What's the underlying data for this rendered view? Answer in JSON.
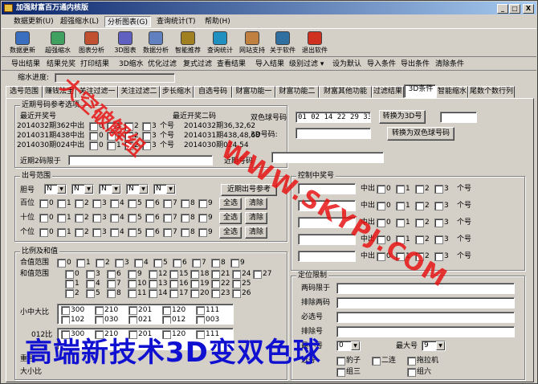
{
  "title": "加强财富百万通内核版",
  "title_buttons": [
    "_",
    "□",
    "X"
  ],
  "menus": [
    "数据更新(U)",
    "超强缩水(L)",
    "分析图表(G)",
    "查询统计(T)",
    "帮助(H)"
  ],
  "toolbar": [
    {
      "label": "数据更新",
      "icon": "database-update-icon",
      "color": "#3a6fc0"
    },
    {
      "label": "超强缩水",
      "icon": "filter-icon",
      "color": "#40a060"
    },
    {
      "label": "图表分析",
      "icon": "chart-icon",
      "color": "#c05030"
    },
    {
      "label": "3D图表",
      "icon": "3d-chart-icon",
      "color": "#6060c0"
    },
    {
      "label": "数据分析",
      "icon": "gear-icon",
      "color": "#6080c0"
    },
    {
      "label": "智能推荐",
      "icon": "magic-wand-icon",
      "color": "#a08020"
    },
    {
      "label": "查询统计",
      "icon": "globe-icon",
      "color": "#2090c0"
    },
    {
      "label": "网站支持",
      "icon": "house-icon",
      "color": "#c08040"
    },
    {
      "label": "关于软件",
      "icon": "info-icon",
      "color": "#3070a0"
    },
    {
      "label": "退出软件",
      "icon": "power-icon",
      "color": "#d03020"
    }
  ],
  "commands": [
    "导出结果",
    "结果兑奖",
    "打印结果",
    "3D缩水",
    "优化过滤",
    "复式过滤",
    "查看结果",
    "导入结果",
    "级别过滤 ▾",
    "设为默认",
    "导入条件",
    "导出条件",
    "清除条件"
  ],
  "progress_label": "缩水进度:",
  "tabs": [
    "选号范围",
    "赚钱法宝",
    "关注过滤一",
    "关注过滤二",
    "步长缩水",
    "自选号码",
    "财富功能一",
    "财富功能二",
    "财富其他功能",
    "过滤结果",
    "3D条件",
    "智能缩水",
    "尾数个数行列"
  ],
  "recent": {
    "title": "近期号码参考选项",
    "left_header": "最近开奖号",
    "right_header": "最近开奖二码",
    "rows": [
      {
        "period": "2014032期362中出",
        "count": "个号",
        "prize": "2014032期36,32,62"
      },
      {
        "period": "2014031期438中出",
        "count": "个号",
        "prize": "2014031期438,48,68"
      },
      {
        "period": "2014030期024中出",
        "count": "个号",
        "prize": "2014030期024,54"
      }
    ],
    "boxes": [
      "0",
      "1",
      "2",
      "3"
    ],
    "near_limit": "近期2码限于",
    "near_number": "近期号码"
  },
  "convert": {
    "two_color_label": "双色球号码",
    "two_color_value": "01 02 14 22 29 33",
    "to3d_btn": "转换为3D号",
    "d3_label": "3D号码:",
    "to2color_btn": "转换为双色球号码"
  },
  "range": {
    "title": "出号范围",
    "gall": "胆号",
    "combo": [
      "N",
      "N",
      "N",
      "N",
      "N"
    ],
    "recent_btn": "近期出号参考",
    "rows": [
      "百位",
      "十位",
      "个位"
    ],
    "digits": [
      "0",
      "1",
      "2",
      "3",
      "4",
      "5",
      "6",
      "7",
      "8",
      "9"
    ],
    "all_btn": "全选",
    "clear_btn": "清除"
  },
  "sum": {
    "title": "比例及和值",
    "he_range": "合值范围",
    "he_vals": [
      "0",
      "1",
      "2",
      "3",
      "4",
      "5",
      "6",
      "7",
      "8",
      "9"
    ],
    "sum_label": "和值范围",
    "sum_vals": [
      "0",
      "3",
      "6",
      "9",
      "12",
      "15",
      "18",
      "21",
      "24",
      "27",
      "1",
      "4",
      "7",
      "10",
      "13",
      "16",
      "19",
      "22",
      "25",
      "2",
      "5",
      "8",
      "11",
      "14",
      "17",
      "20",
      "23",
      "26"
    ],
    "big_small": "小中大比",
    "bs_vals": [
      "300",
      "210",
      "201",
      "120",
      "111",
      "102",
      "030",
      "021",
      "012",
      "003"
    ],
    "odd_even": "012比",
    "oe_vals": [
      "300",
      "210",
      "201",
      "120",
      "111"
    ],
    "last1": "重号",
    "last2": "大小比"
  },
  "control": {
    "title": "控制中奖号",
    "hit": "中出",
    "unit": "个号",
    "boxes": [
      "0",
      "1",
      "2",
      "3"
    ]
  },
  "position": {
    "title": "定位限制",
    "two_limit": "两码限于",
    "excl_limit": "排除两码",
    "must_select": "必选号",
    "excl_num": "排除号",
    "small_label": "最小号",
    "small_val": "0",
    "big_label": "最大号",
    "big_val": "9",
    "shape": "选号",
    "shape_opts": [
      "豹子",
      "二连",
      "拖拉机",
      "组三",
      "组六"
    ]
  },
  "watermark": {
    "crack": "大空破解组",
    "url": "WWW.SKYPJ.COM",
    "ad": "高端新技术3D变双色球"
  }
}
